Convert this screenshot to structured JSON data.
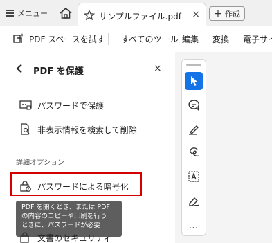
{
  "tabbar": {
    "menu_label": "メニュー",
    "tab_title": "サンプルファイル.pdf",
    "tab_close": "×",
    "new_label": "作成",
    "new_plus": "+"
  },
  "toolbar": {
    "try_pdf_space": "PDF スペースを試す",
    "all_tools": "すべてのツール",
    "edit": "編集",
    "convert": "変換",
    "esign": "電子サイ"
  },
  "panel": {
    "title": "PDF を保護",
    "close": "×",
    "protect_with_password": "パスワードで保護",
    "redact": "非表示情報を検索して削除",
    "advanced_label": "詳細オプション",
    "encrypt_with_password": "パスワードによる暗号化",
    "tooltip_lines": [
      "PDF を開くとき、または PDF",
      "の内容のコピーや印刷を行う",
      "ときに、パスワードが必要"
    ],
    "document_security": "文書のセキュリティ"
  },
  "rail": {
    "more": "…"
  },
  "colors": {
    "highlight_border": "#d40000",
    "selected_tool": "#1473e6",
    "tooltip_bg": "#5e5e5e"
  }
}
